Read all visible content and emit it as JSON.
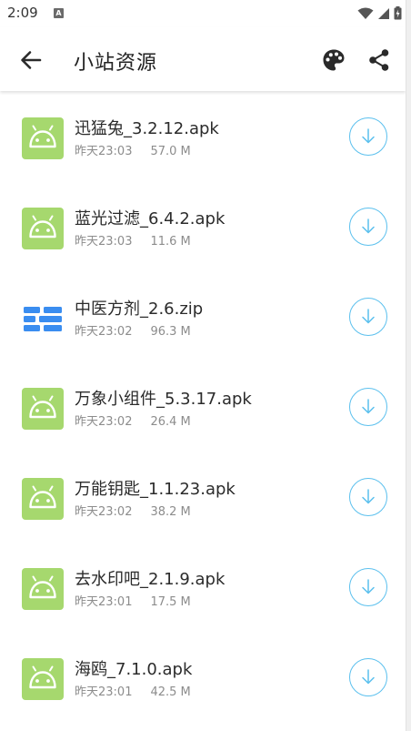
{
  "status_bar": {
    "time": "2:09",
    "notification_letter": "A",
    "icons": [
      "wifi-icon",
      "signal-icon",
      "battery-icon"
    ]
  },
  "app_bar": {
    "title": "小站资源",
    "icons": [
      "back-arrow-icon",
      "palette-icon",
      "share-icon"
    ]
  },
  "files": [
    {
      "name": "迅猛兔_3.2.12.apk",
      "time": "昨天23:03",
      "size": "57.0 M",
      "type": "apk"
    },
    {
      "name": "蓝光过滤_6.4.2.apk",
      "time": "昨天23:03",
      "size": "11.6 M",
      "type": "apk"
    },
    {
      "name": "中医方剂_2.6.zip",
      "time": "昨天23:02",
      "size": "96.3 M",
      "type": "zip"
    },
    {
      "name": "万象小组件_5.3.17.apk",
      "time": "昨天23:02",
      "size": "26.4 M",
      "type": "apk"
    },
    {
      "name": "万能钥匙_1.1.23.apk",
      "time": "昨天23:02",
      "size": "38.2 M",
      "type": "apk"
    },
    {
      "name": "去水印吧_2.1.9.apk",
      "time": "昨天23:01",
      "size": "17.5 M",
      "type": "apk"
    },
    {
      "name": "海鸥_7.1.0.apk",
      "time": "昨天23:01",
      "size": "42.5 M",
      "type": "apk"
    }
  ],
  "colors": {
    "apk_icon_bg": "#a6d86e",
    "zip_icon": "#3a8df0",
    "download_accent": "#5bc0ee"
  }
}
